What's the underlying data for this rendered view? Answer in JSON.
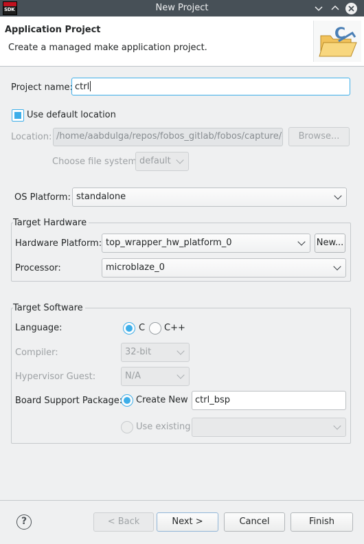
{
  "window": {
    "title": "New Project",
    "app_icon_text": "SDK",
    "minimize_icon": "chevron-down-icon",
    "maximize_icon": "chevron-up-icon",
    "close_icon": "close-icon"
  },
  "header": {
    "title": "Application Project",
    "description": "Create a managed make application project."
  },
  "project": {
    "name_label": "Project name:",
    "name_value": "ctrl",
    "use_default_label": "Use default location",
    "location_label": "Location:",
    "location_value": "/home/aabdulga/repos/fobos_gitlab/fobos/capture/ctrl",
    "browse_label": "Browse...",
    "filesystem_label": "Choose file system:",
    "filesystem_value": "default"
  },
  "os": {
    "label": "OS Platform:",
    "value": "standalone"
  },
  "hardware": {
    "group_title": "Target Hardware",
    "platform_label": "Hardware Platform:",
    "platform_value": "top_wrapper_hw_platform_0",
    "new_label": "New...",
    "processor_label": "Processor:",
    "processor_value": "microblaze_0"
  },
  "software": {
    "group_title": "Target Software",
    "language_label": "Language:",
    "lang_c": "C",
    "lang_cpp": "C++",
    "compiler_label": "Compiler:",
    "compiler_value": "32-bit",
    "hypervisor_label": "Hypervisor Guest:",
    "hypervisor_value": "N/A",
    "bsp_label": "Board Support Package:",
    "create_new_label": "Create New",
    "bsp_name": "ctrl_bsp",
    "use_existing_label": "Use existing",
    "existing_value": ""
  },
  "footer": {
    "help": "?",
    "back": "< Back",
    "next": "Next >",
    "cancel": "Cancel",
    "finish": "Finish"
  },
  "colors": {
    "accent": "#3daee9",
    "titlebar": "#475057",
    "background": "#eff0f1"
  }
}
